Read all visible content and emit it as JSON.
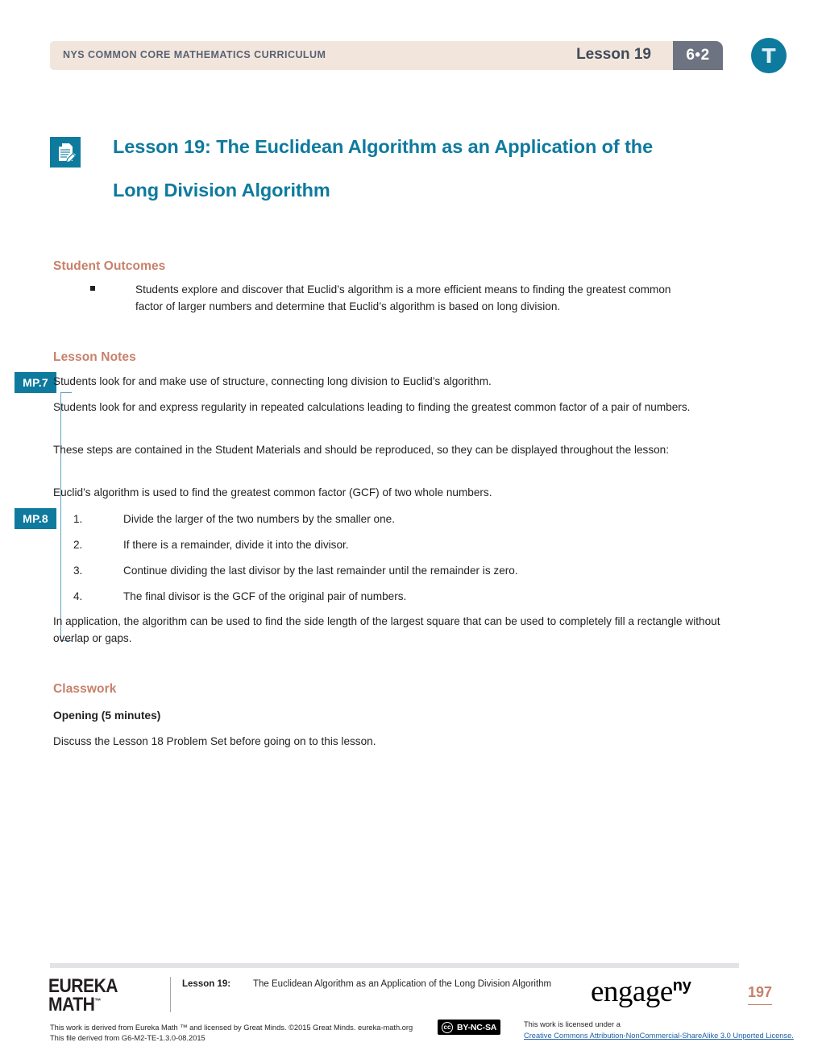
{
  "header": {
    "curriculum": "NYS COMMON CORE MATHEMATICS CURRICULUM",
    "lesson": "Lesson 19",
    "module": "6•2",
    "teacher_mark": "T",
    "icons": {
      "teacher_badge": "teacher-circle-icon",
      "module_badge": "module-badge"
    },
    "colors": {
      "bar_background": "#f2e6dc",
      "module_badge": "#6d7380",
      "teal": "#0e7a9e"
    }
  },
  "title": {
    "icon": "document-with-pencil-icon",
    "line1": "Lesson 19:  The Euclidean Algorithm as an Application of the",
    "line2": "Long Division Algorithm",
    "color": "#0e7a9e"
  },
  "student_outcomes": {
    "heading": "Student Outcomes",
    "bullets": [
      "Students explore and discover that Euclid’s algorithm is a more efficient means to finding the greatest common factor of larger numbers and determine that Euclid’s algorithm is based on long division."
    ]
  },
  "lesson_notes": {
    "heading": "Lesson Notes",
    "mp_badges": [
      {
        "label": "MP.7"
      },
      {
        "label": "MP.8"
      }
    ],
    "paragraphs": [
      "Students look for and make use of structure, connecting long division to Euclid’s algorithm.",
      "Students look for and express regularity in repeated calculations leading to finding the greatest common factor of a pair of numbers.",
      "These steps are contained in the Student Materials and should be reproduced, so they can be displayed throughout the lesson:",
      "Euclid’s algorithm is used to find the greatest common factor (GCF) of two whole numbers."
    ],
    "steps": [
      {
        "number": "1.",
        "text": "Divide the larger of the two numbers by the smaller one."
      },
      {
        "number": "2.",
        "text": "If there is a remainder, divide it into the divisor."
      },
      {
        "number": "3.",
        "text": "Continue dividing the last divisor by the last remainder until the remainder is zero."
      },
      {
        "number": "4.",
        "text": "The final divisor is the GCF of the original pair of numbers."
      }
    ],
    "closing": "In application, the algorithm can be used to find the side length of the largest square that can be used to completely fill a rectangle without overlap or gaps."
  },
  "classwork": {
    "heading": "Classwork",
    "opening_heading": "Opening  (5 minutes)",
    "opening_text": "Discuss the Lesson 18 Problem Set before going on to this lesson."
  },
  "footer": {
    "eureka_line1": "EUREKA",
    "eureka_line2": "MATH",
    "eureka_tm": "™",
    "lesson_label": "Lesson 19:",
    "lesson_title": "The Euclidean Algorithm as an Application of the Long Division Algorithm",
    "engage_main": "engage",
    "engage_sup": "ny",
    "page_number": "197",
    "license_left_line1": "This work is derived from Eureka Math ™ and licensed by Great Minds. ©2015 Great Minds. eureka-math.org",
    "license_left_line2": "This file derived from G6-M2-TE-1.3.0-08.2015",
    "cc_mark": "cc",
    "cc_label": "BY-NC-SA",
    "license_right_line1": "This work is licensed under a",
    "license_right_link": "Creative Commons Attribution-NonCommercial-ShareAlike 3.0 Unported License."
  }
}
